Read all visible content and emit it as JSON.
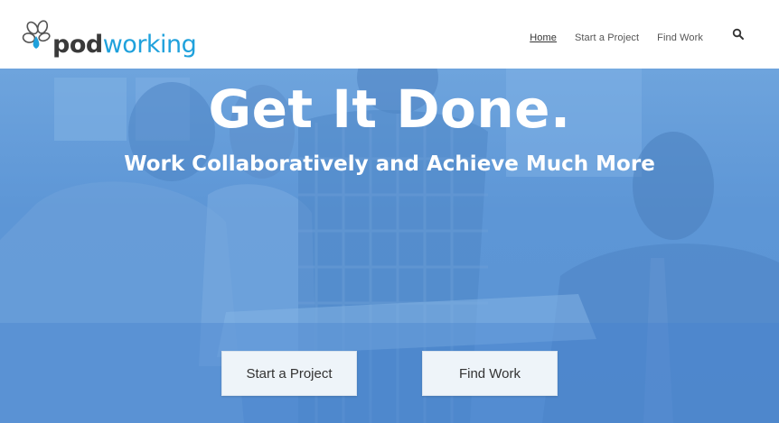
{
  "brand": {
    "name_part1": "pod",
    "name_part2": "working",
    "color_dark": "#3a3a3a",
    "color_accent": "#1fa1dc"
  },
  "nav": {
    "items": [
      {
        "label": "Home",
        "active": true
      },
      {
        "label": "Start a Project",
        "active": false
      },
      {
        "label": "Find Work",
        "active": false
      }
    ],
    "search_icon": "search-icon"
  },
  "hero": {
    "title": "Get It Done.",
    "subtitle": "Work Collaboratively and Achieve Much More",
    "overlay_color": "#5b93d3",
    "buttons": {
      "start_label": "Start a Project",
      "find_label": "Find Work"
    }
  }
}
